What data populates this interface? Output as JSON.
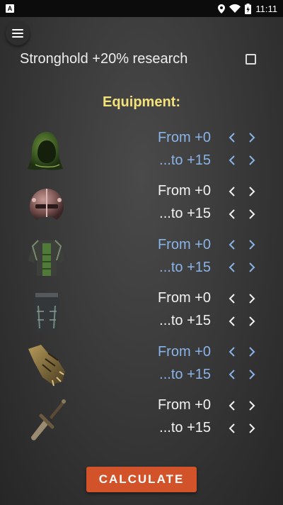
{
  "status_bar": {
    "time": "11:11",
    "notif_letter": "A"
  },
  "research": {
    "label": "Stronghold +20% research",
    "checked": false
  },
  "equipment": {
    "title": "Equipment:",
    "items": [
      {
        "name": "hood",
        "icon": "hood-icon",
        "from_label": "From +0",
        "to_label": "...to +15",
        "color": "blue"
      },
      {
        "name": "helmet",
        "icon": "helmet-icon",
        "from_label": "From +0",
        "to_label": "...to +15",
        "color": "white"
      },
      {
        "name": "armor",
        "icon": "armor-icon",
        "from_label": "From +0",
        "to_label": "...to +15",
        "color": "blue"
      },
      {
        "name": "leggings",
        "icon": "leggings-icon",
        "from_label": "From +0",
        "to_label": "...to +15",
        "color": "white"
      },
      {
        "name": "gauntlet",
        "icon": "gauntlet-icon",
        "from_label": "From +0",
        "to_label": "...to +15",
        "color": "blue"
      },
      {
        "name": "weapon",
        "icon": "dagger-icon",
        "from_label": "From +0",
        "to_label": "...to +15",
        "color": "white"
      }
    ]
  },
  "calculate_label": "CALCULATE",
  "colors": {
    "blue_text": "#8ab4e8",
    "title": "#f3e27a",
    "button": "#d2532a"
  }
}
